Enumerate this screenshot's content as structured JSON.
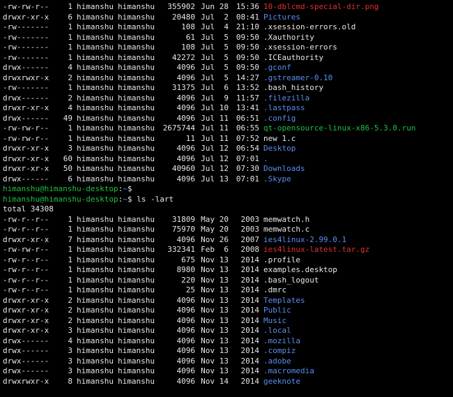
{
  "listing1": [
    {
      "perm": "-rw-rw-r--",
      "links": "1",
      "owner": "himanshu",
      "group": "himanshu",
      "size": "355902",
      "mon": "Jun",
      "day": "28",
      "time": "15:36",
      "name": "10-dblcmd-special-dir.png",
      "cls": "red"
    },
    {
      "perm": "drwxr-xr-x",
      "links": "6",
      "owner": "himanshu",
      "group": "himanshu",
      "size": "20480",
      "mon": "Jul",
      "day": "2",
      "time": "08:41",
      "name": "Pictures",
      "cls": "blue"
    },
    {
      "perm": "-rw-------",
      "links": "1",
      "owner": "himanshu",
      "group": "himanshu",
      "size": "108",
      "mon": "Jul",
      "day": "4",
      "time": "21:10",
      "name": ".xsession-errors.old",
      "cls": "white"
    },
    {
      "perm": "-rw-------",
      "links": "1",
      "owner": "himanshu",
      "group": "himanshu",
      "size": "61",
      "mon": "Jul",
      "day": "5",
      "time": "09:50",
      "name": ".Xauthority",
      "cls": "white"
    },
    {
      "perm": "-rw-------",
      "links": "1",
      "owner": "himanshu",
      "group": "himanshu",
      "size": "108",
      "mon": "Jul",
      "day": "5",
      "time": "09:50",
      "name": ".xsession-errors",
      "cls": "white"
    },
    {
      "perm": "-rw-------",
      "links": "1",
      "owner": "himanshu",
      "group": "himanshu",
      "size": "42272",
      "mon": "Jul",
      "day": "5",
      "time": "09:50",
      "name": ".ICEauthority",
      "cls": "white"
    },
    {
      "perm": "drwx------",
      "links": "4",
      "owner": "himanshu",
      "group": "himanshu",
      "size": "4096",
      "mon": "Jul",
      "day": "5",
      "time": "09:50",
      "name": ".gconf",
      "cls": "blue"
    },
    {
      "perm": "drwxrwxr-x",
      "links": "2",
      "owner": "himanshu",
      "group": "himanshu",
      "size": "4096",
      "mon": "Jul",
      "day": "5",
      "time": "14:27",
      "name": ".gstreamer-0.10",
      "cls": "blue"
    },
    {
      "perm": "-rw-------",
      "links": "1",
      "owner": "himanshu",
      "group": "himanshu",
      "size": "31375",
      "mon": "Jul",
      "day": "6",
      "time": "13:52",
      "name": ".bash_history",
      "cls": "white"
    },
    {
      "perm": "drwx------",
      "links": "2",
      "owner": "himanshu",
      "group": "himanshu",
      "size": "4096",
      "mon": "Jul",
      "day": "9",
      "time": "11:57",
      "name": ".filezilla",
      "cls": "blue"
    },
    {
      "perm": "drwxr-xr-x",
      "links": "4",
      "owner": "himanshu",
      "group": "himanshu",
      "size": "4096",
      "mon": "Jul",
      "day": "10",
      "time": "13:41",
      "name": ".lastpass",
      "cls": "blue"
    },
    {
      "perm": "drwx------",
      "links": "49",
      "owner": "himanshu",
      "group": "himanshu",
      "size": "4096",
      "mon": "Jul",
      "day": "11",
      "time": "06:51",
      "name": ".config",
      "cls": "blue"
    },
    {
      "perm": "-rw-rw-r--",
      "links": "1",
      "owner": "himanshu",
      "group": "himanshu",
      "size": "2675744",
      "mon": "Jul",
      "day": "11",
      "time": "06:55",
      "name": "qt-opensource-linux-x86-5.3.0.run",
      "cls": "green"
    },
    {
      "perm": "-rw-rw-r--",
      "links": "1",
      "owner": "himanshu",
      "group": "himanshu",
      "size": "11",
      "mon": "Jul",
      "day": "11",
      "time": "07:52",
      "name": "new 1.c",
      "cls": "white"
    },
    {
      "perm": "drwxr-xr-x",
      "links": "3",
      "owner": "himanshu",
      "group": "himanshu",
      "size": "4096",
      "mon": "Jul",
      "day": "12",
      "time": "06:54",
      "name": "Desktop",
      "cls": "blue"
    },
    {
      "perm": "drwxr-xr-x",
      "links": "60",
      "owner": "himanshu",
      "group": "himanshu",
      "size": "4096",
      "mon": "Jul",
      "day": "12",
      "time": "07:01",
      "name": ".",
      "cls": "blue"
    },
    {
      "perm": "drwxr-xr-x",
      "links": "50",
      "owner": "himanshu",
      "group": "himanshu",
      "size": "40960",
      "mon": "Jul",
      "day": "12",
      "time": "07:30",
      "name": "Downloads",
      "cls": "blue"
    },
    {
      "perm": "drwx------",
      "links": "6",
      "owner": "himanshu",
      "group": "himanshu",
      "size": "4096",
      "mon": "Jul",
      "day": "13",
      "time": "07:01",
      "name": ".Skype",
      "cls": "blue"
    }
  ],
  "prompt": {
    "user_host": "himanshu@himanshu-desktop",
    "sep1": ":",
    "path": "~",
    "sep2": "$",
    "cmd": "ls -lart"
  },
  "total_line": "total 34308",
  "listing2": [
    {
      "perm": "-rw-r--r--",
      "links": "1",
      "owner": "himanshu",
      "group": "himanshu",
      "size": "31809",
      "mon": "May",
      "day": "20",
      "time": "2003",
      "name": "memwatch.h",
      "cls": "white"
    },
    {
      "perm": "-rw-r--r--",
      "links": "1",
      "owner": "himanshu",
      "group": "himanshu",
      "size": "75970",
      "mon": "May",
      "day": "20",
      "time": "2003",
      "name": "memwatch.c",
      "cls": "white"
    },
    {
      "perm": "drwxr-xr-x",
      "links": "7",
      "owner": "himanshu",
      "group": "himanshu",
      "size": "4096",
      "mon": "Nov",
      "day": "26",
      "time": "2007",
      "name": "ies4linux-2.99.0.1",
      "cls": "blue"
    },
    {
      "perm": "-rw-rw-r--",
      "links": "1",
      "owner": "himanshu",
      "group": "himanshu",
      "size": "332341",
      "mon": "Feb",
      "day": "6",
      "time": "2008",
      "name": "ies4linux-latest.tar.gz",
      "cls": "red"
    },
    {
      "perm": "-rw-r--r--",
      "links": "1",
      "owner": "himanshu",
      "group": "himanshu",
      "size": "675",
      "mon": "Nov",
      "day": "13",
      "time": "2014",
      "name": ".profile",
      "cls": "white"
    },
    {
      "perm": "-rw-r--r--",
      "links": "1",
      "owner": "himanshu",
      "group": "himanshu",
      "size": "8980",
      "mon": "Nov",
      "day": "13",
      "time": "2014",
      "name": "examples.desktop",
      "cls": "white"
    },
    {
      "perm": "-rw-r--r--",
      "links": "1",
      "owner": "himanshu",
      "group": "himanshu",
      "size": "220",
      "mon": "Nov",
      "day": "13",
      "time": "2014",
      "name": ".bash_logout",
      "cls": "white"
    },
    {
      "perm": "-rw-r--r--",
      "links": "1",
      "owner": "himanshu",
      "group": "himanshu",
      "size": "25",
      "mon": "Nov",
      "day": "13",
      "time": "2014",
      "name": ".dmrc",
      "cls": "white"
    },
    {
      "perm": "drwxr-xr-x",
      "links": "2",
      "owner": "himanshu",
      "group": "himanshu",
      "size": "4096",
      "mon": "Nov",
      "day": "13",
      "time": "2014",
      "name": "Templates",
      "cls": "blue"
    },
    {
      "perm": "drwxr-xr-x",
      "links": "2",
      "owner": "himanshu",
      "group": "himanshu",
      "size": "4096",
      "mon": "Nov",
      "day": "13",
      "time": "2014",
      "name": "Public",
      "cls": "blue"
    },
    {
      "perm": "drwxr-xr-x",
      "links": "2",
      "owner": "himanshu",
      "group": "himanshu",
      "size": "4096",
      "mon": "Nov",
      "day": "13",
      "time": "2014",
      "name": "Music",
      "cls": "blue"
    },
    {
      "perm": "drwxr-xr-x",
      "links": "3",
      "owner": "himanshu",
      "group": "himanshu",
      "size": "4096",
      "mon": "Nov",
      "day": "13",
      "time": "2014",
      "name": ".local",
      "cls": "blue"
    },
    {
      "perm": "drwx------",
      "links": "4",
      "owner": "himanshu",
      "group": "himanshu",
      "size": "4096",
      "mon": "Nov",
      "day": "13",
      "time": "2014",
      "name": ".mozilla",
      "cls": "blue"
    },
    {
      "perm": "drwx------",
      "links": "3",
      "owner": "himanshu",
      "group": "himanshu",
      "size": "4096",
      "mon": "Nov",
      "day": "13",
      "time": "2014",
      "name": ".compiz",
      "cls": "blue"
    },
    {
      "perm": "drwx------",
      "links": "3",
      "owner": "himanshu",
      "group": "himanshu",
      "size": "4096",
      "mon": "Nov",
      "day": "13",
      "time": "2014",
      "name": ".adobe",
      "cls": "blue"
    },
    {
      "perm": "drwx------",
      "links": "3",
      "owner": "himanshu",
      "group": "himanshu",
      "size": "4096",
      "mon": "Nov",
      "day": "13",
      "time": "2014",
      "name": ".macromedia",
      "cls": "blue"
    },
    {
      "perm": "drwxrwxr-x",
      "links": "8",
      "owner": "himanshu",
      "group": "himanshu",
      "size": "4096",
      "mon": "Nov",
      "day": "14",
      "time": "2014",
      "name": "geeknote",
      "cls": "blue"
    }
  ]
}
